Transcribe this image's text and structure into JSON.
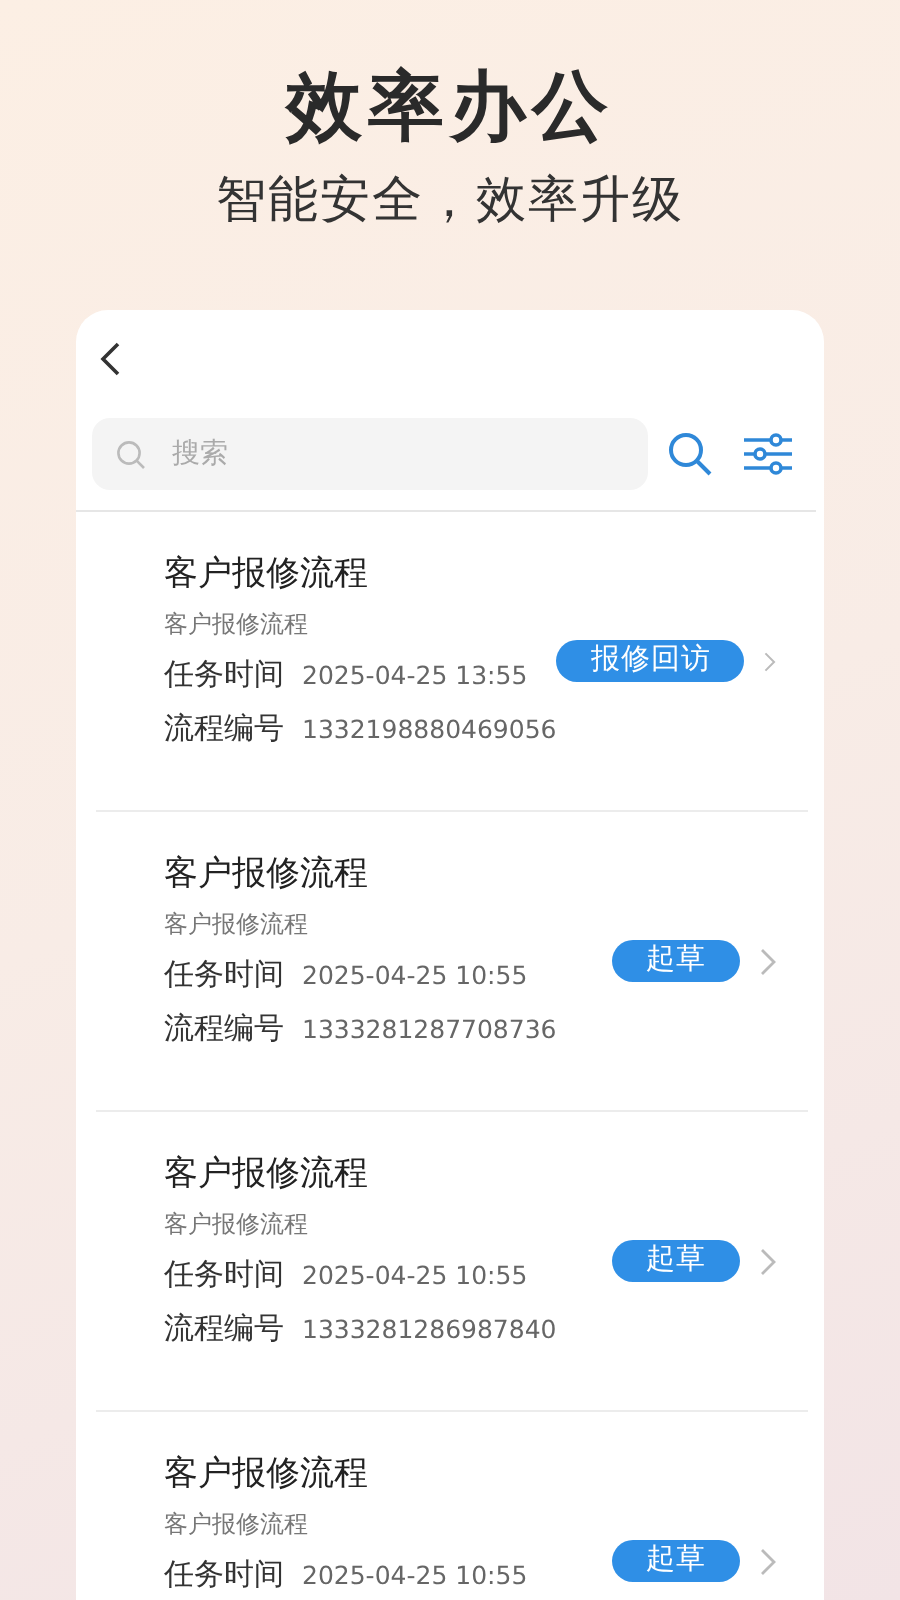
{
  "headline": "效率办公",
  "subheadline": "智能安全，效率升级",
  "search": {
    "placeholder": "搜索"
  },
  "tasks": [
    {
      "title": "客户报修流程",
      "subtitle": "客户报修流程",
      "status": "报修回访",
      "fields": [
        {
          "label": "任务时间",
          "value": "2025-04-25 13:55"
        },
        {
          "label": "流程编号",
          "value": "1332198880469056"
        }
      ]
    },
    {
      "title": "客户报修流程",
      "subtitle": "客户报修流程",
      "status": "起草",
      "fields": [
        {
          "label": "任务时间",
          "value": "2025-04-25 10:55"
        },
        {
          "label": "流程编号",
          "value": "1333281287708736"
        }
      ]
    },
    {
      "title": "客户报修流程",
      "subtitle": "客户报修流程",
      "status": "起草",
      "fields": [
        {
          "label": "任务时间",
          "value": "2025-04-25 10:55"
        },
        {
          "label": "流程编号",
          "value": "1333281286987840"
        }
      ]
    },
    {
      "title": "客户报修流程",
      "subtitle": "客户报修流程",
      "status": "起草",
      "fields": [
        {
          "label": "任务时间",
          "value": "2025-04-25 10:55"
        }
      ]
    }
  ]
}
